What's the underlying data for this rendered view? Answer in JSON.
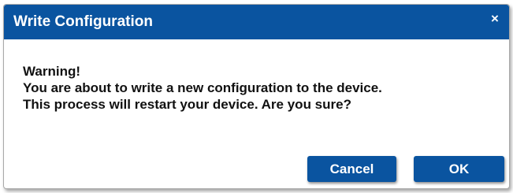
{
  "dialog": {
    "title": "Write Configuration",
    "close_icon": "×",
    "message": {
      "line1": "Warning!",
      "line2": "You are about to write a new configuration to the device.",
      "line3": "This process will restart your device. Are you sure?"
    },
    "buttons": {
      "cancel_label": "Cancel",
      "ok_label": "OK"
    }
  },
  "colors": {
    "titlebar": "#0a54a0",
    "button": "#0a54a0",
    "text": "#111111"
  }
}
